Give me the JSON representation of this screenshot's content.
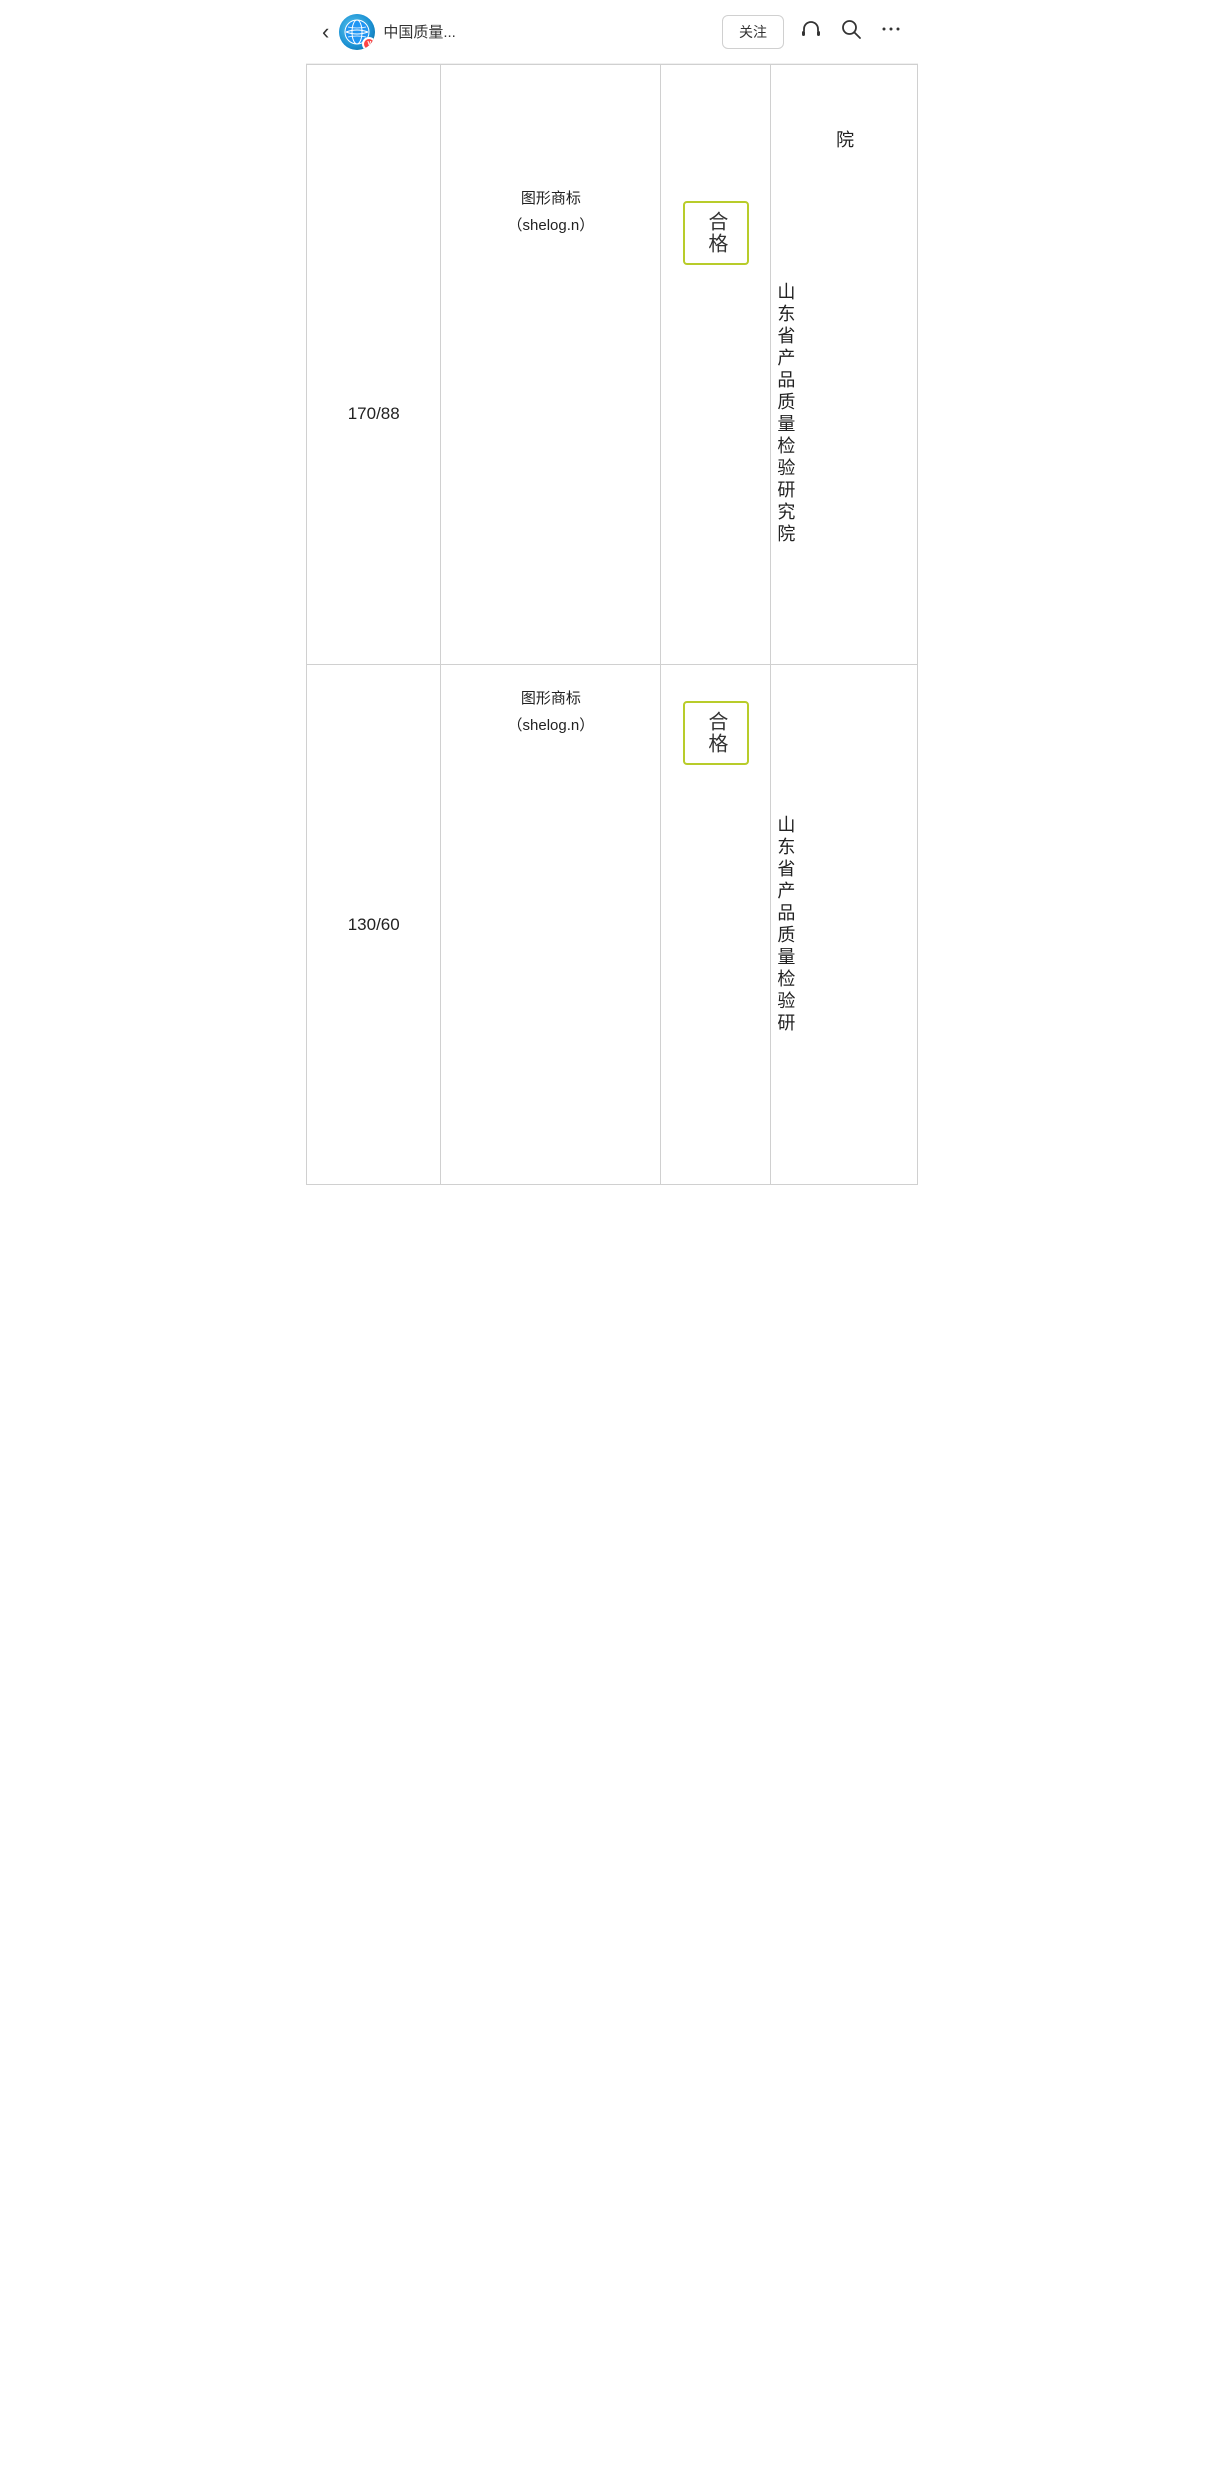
{
  "nav": {
    "back_label": "‹",
    "avatar_alt": "中国质量avatar",
    "badge_text": "v",
    "title": "中国质量...",
    "follow_label": "关注",
    "icon_headphone": "headphone",
    "icon_search": "search",
    "icon_more": "more"
  },
  "table": {
    "partial_top": {
      "org_text_partial": "院"
    },
    "row1": {
      "size": "170/88",
      "trademark": "图形商标",
      "trademark_sub": "（shelog.n）",
      "result": "合格",
      "org_chars": [
        "山",
        "东",
        "省",
        "产",
        "品",
        "质",
        "量",
        "检",
        "验",
        "研",
        "究",
        "院"
      ]
    },
    "row2": {
      "size": "130/60",
      "trademark": "图形商标",
      "trademark_sub": "（shelog.n）",
      "result": "合格",
      "org_chars": [
        "山",
        "东",
        "省",
        "产",
        "品",
        "质",
        "量",
        "检",
        "验",
        "研"
      ]
    }
  },
  "accent_color": "#b8cc2a"
}
